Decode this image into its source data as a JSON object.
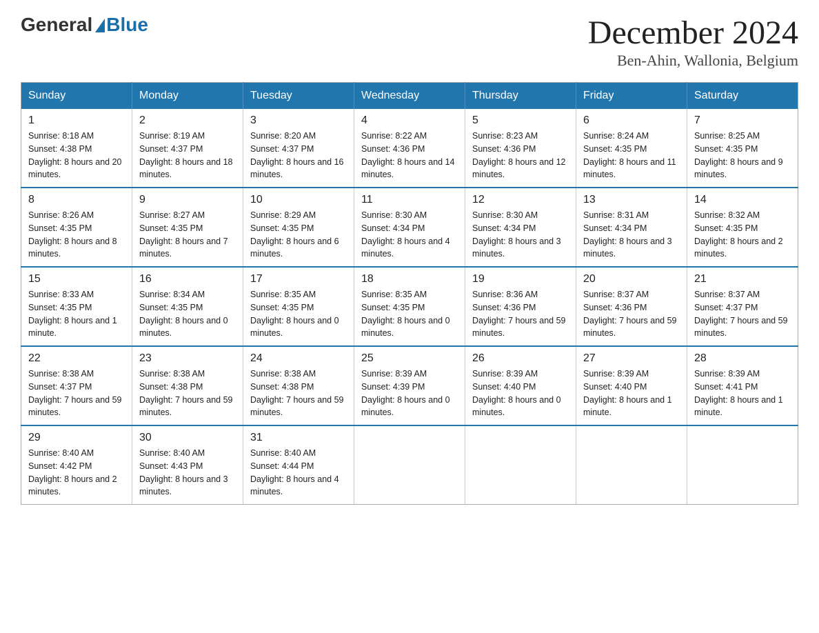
{
  "logo": {
    "general": "General",
    "blue": "Blue"
  },
  "title": "December 2024",
  "subtitle": "Ben-Ahin, Wallonia, Belgium",
  "weekdays": [
    "Sunday",
    "Monday",
    "Tuesday",
    "Wednesday",
    "Thursday",
    "Friday",
    "Saturday"
  ],
  "weeks": [
    [
      {
        "day": "1",
        "sunrise": "8:18 AM",
        "sunset": "4:38 PM",
        "daylight": "8 hours and 20 minutes."
      },
      {
        "day": "2",
        "sunrise": "8:19 AM",
        "sunset": "4:37 PM",
        "daylight": "8 hours and 18 minutes."
      },
      {
        "day": "3",
        "sunrise": "8:20 AM",
        "sunset": "4:37 PM",
        "daylight": "8 hours and 16 minutes."
      },
      {
        "day": "4",
        "sunrise": "8:22 AM",
        "sunset": "4:36 PM",
        "daylight": "8 hours and 14 minutes."
      },
      {
        "day": "5",
        "sunrise": "8:23 AM",
        "sunset": "4:36 PM",
        "daylight": "8 hours and 12 minutes."
      },
      {
        "day": "6",
        "sunrise": "8:24 AM",
        "sunset": "4:35 PM",
        "daylight": "8 hours and 11 minutes."
      },
      {
        "day": "7",
        "sunrise": "8:25 AM",
        "sunset": "4:35 PM",
        "daylight": "8 hours and 9 minutes."
      }
    ],
    [
      {
        "day": "8",
        "sunrise": "8:26 AM",
        "sunset": "4:35 PM",
        "daylight": "8 hours and 8 minutes."
      },
      {
        "day": "9",
        "sunrise": "8:27 AM",
        "sunset": "4:35 PM",
        "daylight": "8 hours and 7 minutes."
      },
      {
        "day": "10",
        "sunrise": "8:29 AM",
        "sunset": "4:35 PM",
        "daylight": "8 hours and 6 minutes."
      },
      {
        "day": "11",
        "sunrise": "8:30 AM",
        "sunset": "4:34 PM",
        "daylight": "8 hours and 4 minutes."
      },
      {
        "day": "12",
        "sunrise": "8:30 AM",
        "sunset": "4:34 PM",
        "daylight": "8 hours and 3 minutes."
      },
      {
        "day": "13",
        "sunrise": "8:31 AM",
        "sunset": "4:34 PM",
        "daylight": "8 hours and 3 minutes."
      },
      {
        "day": "14",
        "sunrise": "8:32 AM",
        "sunset": "4:35 PM",
        "daylight": "8 hours and 2 minutes."
      }
    ],
    [
      {
        "day": "15",
        "sunrise": "8:33 AM",
        "sunset": "4:35 PM",
        "daylight": "8 hours and 1 minute."
      },
      {
        "day": "16",
        "sunrise": "8:34 AM",
        "sunset": "4:35 PM",
        "daylight": "8 hours and 0 minutes."
      },
      {
        "day": "17",
        "sunrise": "8:35 AM",
        "sunset": "4:35 PM",
        "daylight": "8 hours and 0 minutes."
      },
      {
        "day": "18",
        "sunrise": "8:35 AM",
        "sunset": "4:35 PM",
        "daylight": "8 hours and 0 minutes."
      },
      {
        "day": "19",
        "sunrise": "8:36 AM",
        "sunset": "4:36 PM",
        "daylight": "7 hours and 59 minutes."
      },
      {
        "day": "20",
        "sunrise": "8:37 AM",
        "sunset": "4:36 PM",
        "daylight": "7 hours and 59 minutes."
      },
      {
        "day": "21",
        "sunrise": "8:37 AM",
        "sunset": "4:37 PM",
        "daylight": "7 hours and 59 minutes."
      }
    ],
    [
      {
        "day": "22",
        "sunrise": "8:38 AM",
        "sunset": "4:37 PM",
        "daylight": "7 hours and 59 minutes."
      },
      {
        "day": "23",
        "sunrise": "8:38 AM",
        "sunset": "4:38 PM",
        "daylight": "7 hours and 59 minutes."
      },
      {
        "day": "24",
        "sunrise": "8:38 AM",
        "sunset": "4:38 PM",
        "daylight": "7 hours and 59 minutes."
      },
      {
        "day": "25",
        "sunrise": "8:39 AM",
        "sunset": "4:39 PM",
        "daylight": "8 hours and 0 minutes."
      },
      {
        "day": "26",
        "sunrise": "8:39 AM",
        "sunset": "4:40 PM",
        "daylight": "8 hours and 0 minutes."
      },
      {
        "day": "27",
        "sunrise": "8:39 AM",
        "sunset": "4:40 PM",
        "daylight": "8 hours and 1 minute."
      },
      {
        "day": "28",
        "sunrise": "8:39 AM",
        "sunset": "4:41 PM",
        "daylight": "8 hours and 1 minute."
      }
    ],
    [
      {
        "day": "29",
        "sunrise": "8:40 AM",
        "sunset": "4:42 PM",
        "daylight": "8 hours and 2 minutes."
      },
      {
        "day": "30",
        "sunrise": "8:40 AM",
        "sunset": "4:43 PM",
        "daylight": "8 hours and 3 minutes."
      },
      {
        "day": "31",
        "sunrise": "8:40 AM",
        "sunset": "4:44 PM",
        "daylight": "8 hours and 4 minutes."
      },
      null,
      null,
      null,
      null
    ]
  ]
}
